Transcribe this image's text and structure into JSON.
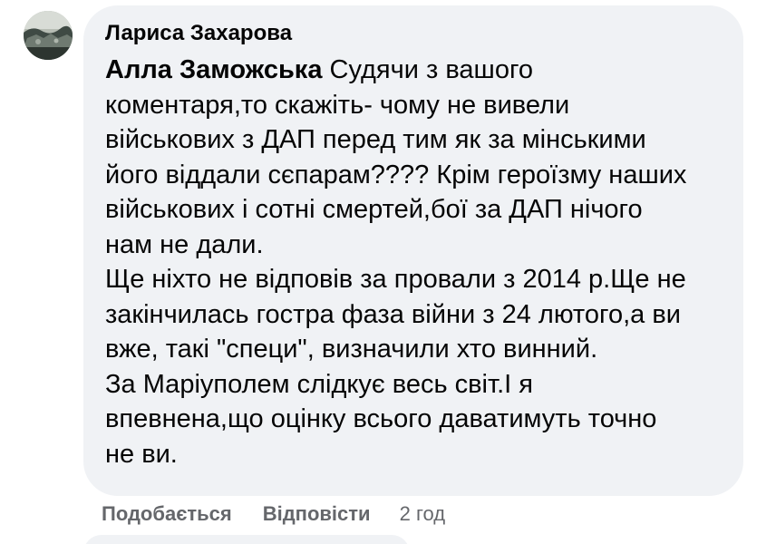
{
  "comment": {
    "author": "Лариса Захарова",
    "mention": "Алла Заможська",
    "lines": [
      "Судячи з вашого",
      "коментаря,то скажіть- чому не вивели",
      "військових з ДАП перед тим як за мінськими",
      "його віддали сєпарам???? Крім героїзму наших",
      "військових і сотні смертей,бої за ДАП нічого",
      "нам не дали.",
      "Ще ніхто не відповів за провали з 2014 р.Ще не",
      "закінчилась гостра фаза війни з 24 лютого,а ви",
      "вже, такі \"специ\", визначили хто винний.",
      "За Маріуполем слідкує весь світ.І я",
      "впевнена,що оцінку всього даватимуть точно",
      "не ви."
    ]
  },
  "actions": {
    "like_label": "Подобається",
    "reply_label": "Відповісти",
    "timestamp": "2 год"
  },
  "colors": {
    "bubble_bg": "#f0f2f5",
    "text": "#050505",
    "secondary_text": "#65676b"
  }
}
